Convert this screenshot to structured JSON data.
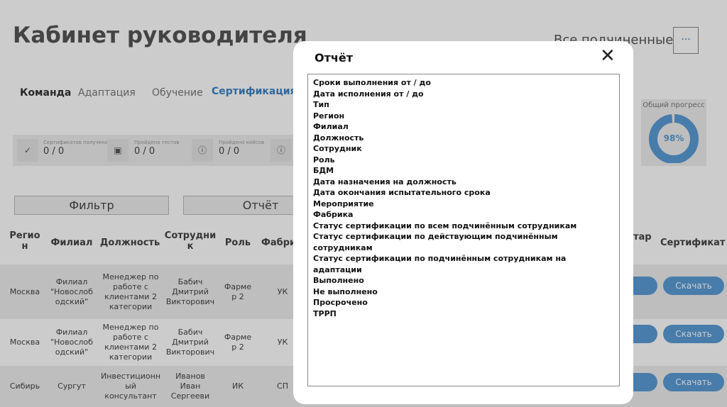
{
  "header": {
    "title": "Кабинет руководителя",
    "subordinates": "Все подчиненные",
    "more": "···"
  },
  "tabs": [
    "Команда",
    "Адаптация",
    "Обучение",
    "Сертификация"
  ],
  "stats": [
    {
      "label": "Сертификатов получено",
      "value": "0 / 0"
    },
    {
      "label": "Пройдено тестов",
      "value": "0 / 0"
    },
    {
      "label": "Пройдено кейсов",
      "value": "0 / 0"
    }
  ],
  "progress": {
    "label": "Общий прогресс",
    "value": "98%",
    "percent": 98
  },
  "buttons": {
    "filter": "Фильтр",
    "report": "Отчёт"
  },
  "table": {
    "headers": [
      "Регио\nн",
      "Филиал",
      "Должность",
      "Сотрудни\nк",
      "Роль",
      "Фабри",
      "тар",
      "Сертификат"
    ],
    "rows": [
      [
        "Москва",
        "Филиал \"Новослоб одский\"",
        "Менеджер по работе с клиентами 2 категории",
        "Бабич Дмитрий Викторович",
        "Фарме р 2",
        "УК"
      ],
      [
        "Москва",
        "Филиал \"Новослоб одский\"",
        "Менеджер по работе с клиентами 2 категории",
        "Бабич Дмитрий Викторович",
        "Фарме р 2",
        "УК"
      ],
      [
        "Сибирь",
        "Сургут",
        "Инвестиционн ый консультант",
        "Иванов Иван Сергееви",
        "ИК",
        "СП"
      ]
    ],
    "download": "Скачать"
  },
  "modal": {
    "title": "Отчёт",
    "items": [
      "Сроки выполнения от / до",
      "Дата исполнения от / до",
      "Тип",
      "Регион",
      "Филиал",
      "Должность",
      "Сотрудник",
      "Роль",
      "БДМ",
      "Дата назначения на должность",
      "Дата окончания испытательного срока",
      "Мероприятие",
      "Фабрика",
      "Статус сертификации по всем подчинённым сотрудникам",
      "Статус сертификации по действующим подчинённым сотрудникам",
      "Статус сертификации по подчинённым сотрудникам на адаптации",
      "Выполнено",
      "Не выполнено",
      "Просрочено",
      "ТРРП"
    ]
  }
}
